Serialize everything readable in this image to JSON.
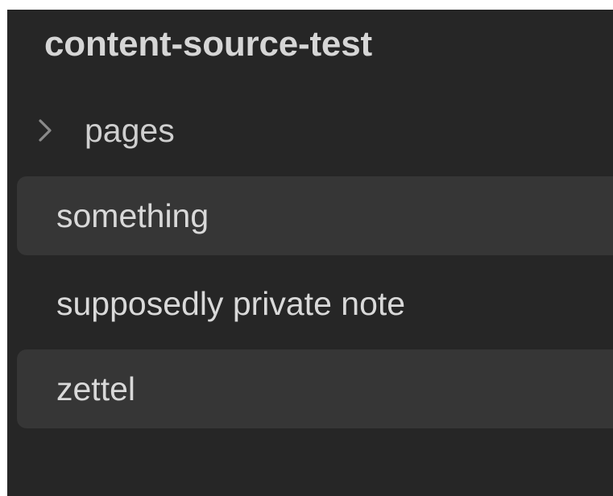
{
  "explorer": {
    "vault_name": "content-source-test",
    "folders": [
      {
        "label": "pages",
        "icon": "chevron-right-icon",
        "expanded": false
      }
    ],
    "files": [
      {
        "label": "something",
        "highlighted": true
      },
      {
        "label": "supposedly private note",
        "highlighted": false
      },
      {
        "label": "zettel",
        "highlighted": true
      }
    ]
  },
  "colors": {
    "background": "#262626",
    "highlight": "#363636",
    "text": "#d9d9d9"
  }
}
